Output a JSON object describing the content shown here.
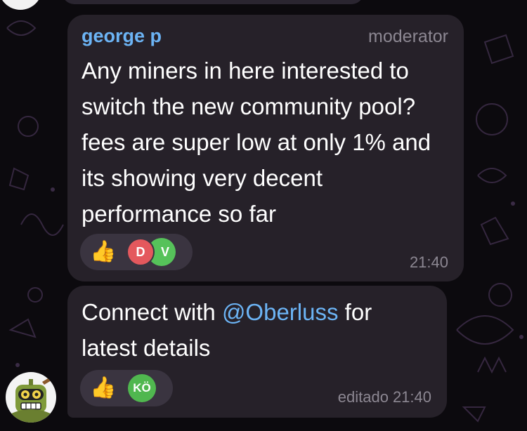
{
  "colors": {
    "background": "#0c0a0e",
    "bubble": "#262129",
    "sender": "#6cb4f5",
    "mention": "#6cb4f5",
    "meta_text": "#8c8792",
    "reaction_pill": "#3a3440"
  },
  "messages": [
    {
      "sender": "george p",
      "role": "moderator",
      "text": "Any miners in here interested to switch the new community pool? fees are super low at only 1% and its showing very decent performance so far",
      "reaction": {
        "emoji": "👍",
        "reactors": [
          "D",
          "V"
        ]
      },
      "time": "21:40"
    },
    {
      "text_before": "Connect with ",
      "mention": "@Oberluss",
      "text_after": " for latest details",
      "reaction": {
        "emoji": "👍",
        "reactors": [
          "KÖ"
        ]
      },
      "edited_label": "editado",
      "time": "21:40"
    }
  ],
  "sender_avatar_icon": "robot-mascot-icon"
}
